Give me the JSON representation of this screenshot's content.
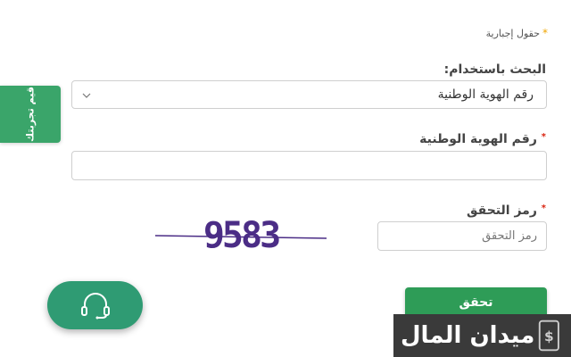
{
  "form": {
    "required_note": "حقول إجبارية",
    "search_by_label": "البحث باستخدام:",
    "search_by_value": "رقم الهوية الوطنية",
    "national_id_label": "رقم الهوية الوطنية",
    "national_id_value": "",
    "captcha_label": "رمز التحقق",
    "captcha_placeholder": "رمز التحقق",
    "captcha_code": "9583",
    "verify_label": "تحقق"
  },
  "side_tab": {
    "label": "قيم تجربتك"
  },
  "watermark": {
    "text": "ميدان المال"
  },
  "icons": {
    "chevron": "chevron-down-icon",
    "support": "headset-icon",
    "logo": "dollar-mobile-icon"
  },
  "colors": {
    "primary_green": "#2e9c57",
    "support_green": "#2f9b73",
    "required_star": "#f0a500",
    "required_red": "#d9230f",
    "captcha_ink": "#4b2d86"
  }
}
